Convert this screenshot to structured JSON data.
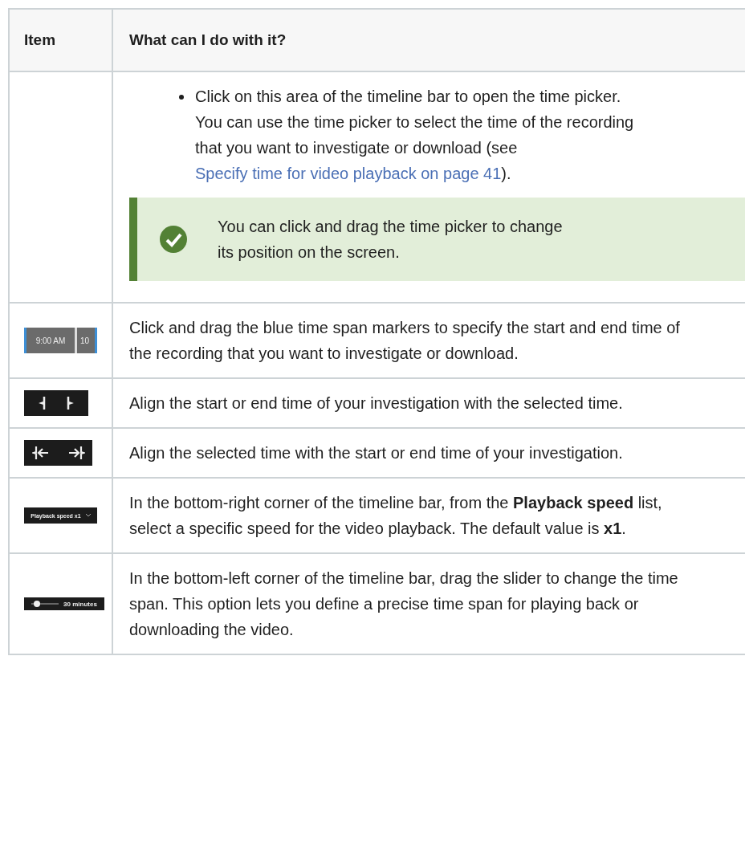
{
  "table": {
    "columns": [
      "Item",
      "What can I do with it?"
    ],
    "rows": [
      {
        "item": {
          "kind": "none"
        },
        "bullet": {
          "text": "Click on this area of the timeline bar to open the time picker. You can use the time picker to select the time of the recording that you want to investigate or download (see ",
          "link": "Specify time for video playback on page 41",
          "after": ")."
        },
        "tip": "You can click and drag the time picker to change its position on the screen."
      },
      {
        "item": {
          "kind": "timespan",
          "labels": [
            "9:00 AM",
            "10"
          ]
        },
        "description": "Click and drag the blue time span markers to specify the start and end time of the recording that you want to investigate or download."
      },
      {
        "item": {
          "kind": "brackets"
        },
        "description": "Align the start or end time of your investigation with the selected time."
      },
      {
        "item": {
          "kind": "arrows"
        },
        "description": "Align the selected time with the start or end time of your investigation."
      },
      {
        "item": {
          "kind": "speed",
          "labels": [
            "Playback speed x1"
          ]
        },
        "description": "In the bottom-right corner of the timeline bar, from the **Playback speed** list, select a specific speed for the video playback. The default value is **x1**."
      },
      {
        "item": {
          "kind": "slider",
          "labels": [
            "30 minutes"
          ],
          "level": 0.2
        },
        "description": "In the bottom-left corner of the timeline bar, drag the slider to change the time span. This option lets you define a precise time span for playing back or downloading the video."
      }
    ]
  }
}
